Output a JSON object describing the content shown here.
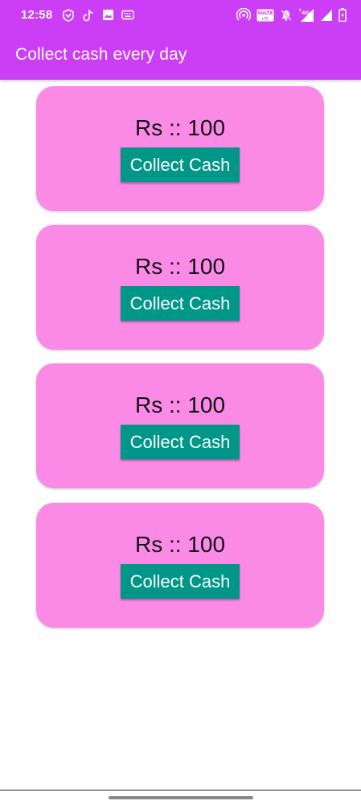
{
  "status_bar": {
    "time": "12:58",
    "left_icons": [
      "vpn-shield-icon",
      "tiktok-icon",
      "image-icon",
      "keyboard-icon"
    ],
    "right_icons": [
      "hotspot-icon",
      "volte-icon",
      "mute-icon",
      "data-signal-icon",
      "signal-icon",
      "battery-icon"
    ],
    "network_label": "4G",
    "volte_label": "VoLTE"
  },
  "app_bar": {
    "title": "Collect cash every day",
    "color": "#cc3df6"
  },
  "cards": [
    {
      "amount": "Rs :: 100",
      "button_label": "Collect Cash"
    },
    {
      "amount": "Rs :: 100",
      "button_label": "Collect Cash"
    },
    {
      "amount": "Rs :: 100",
      "button_label": "Collect Cash"
    },
    {
      "amount": "Rs :: 100",
      "button_label": "Collect Cash"
    }
  ],
  "colors": {
    "card_background": "#fa8ae6",
    "button_background": "#009688",
    "accent": "#cc3df6"
  }
}
